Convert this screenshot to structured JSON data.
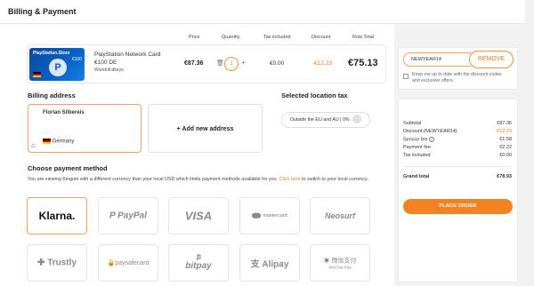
{
  "header": {
    "title": "Billing & Payment"
  },
  "cart": {
    "columns": {
      "price": "Price",
      "quantity": "Quantity",
      "tax": "Tax included",
      "discount": "Discount",
      "row_total": "Row Total"
    },
    "item": {
      "card_title": "PlayStation.Store",
      "card_value": "€100",
      "name_line1": "PlayStation Network Card",
      "name_line2": "€100 DE",
      "seller": "Worldofcdkeys",
      "price": "€87.36",
      "quantity": "1",
      "tax": "€0.00",
      "discount": "-€12.23",
      "row_total": "€75.13"
    }
  },
  "billing": {
    "title": "Billing address",
    "name": "Florian Silbereis",
    "country": "Germany",
    "add_new": "+ Add new address"
  },
  "location_tax": {
    "title": "Selected location tax",
    "value": "Outside the EU and AU | 0%"
  },
  "payment": {
    "title": "Choose payment method",
    "note_before": "You are viewing Kinguin with a different currency than your local USD which limits payment methods available for you. ",
    "note_link": "Click here",
    "note_after": " to switch to your local currency.",
    "methods": [
      "Klarna.",
      "PayPal",
      "VISA",
      "mastercard",
      "Neosurf",
      "Trustly",
      "paysafecard",
      "bitpay",
      "Alipay",
      "微信支付"
    ],
    "wechat_sub": "WeChat Pay"
  },
  "coupon": {
    "code": "NEWYEAR14",
    "remove_label": "REMOVE",
    "keep_text": "Keep me up to date with the discount codes and exclusive offers."
  },
  "summary": {
    "subtotal_label": "Subtotal",
    "subtotal": "€87.36",
    "discount_label": "Discount",
    "discount_code": "(NEWYEAR14)",
    "discount": "-€12.23",
    "service_fee_label": "Service fee",
    "service_fee": "€1.58",
    "payment_fee_label": "Payment fee",
    "payment_fee": "€2.22",
    "tax_label": "Tax included",
    "tax": "€0.00",
    "grand_label": "Grand total",
    "grand": "€78.93",
    "place_order": "PLACE ORDER"
  },
  "colors": {
    "accent": "#f58220",
    "discount": "#f07b22",
    "psn_blue": "#0a62c8"
  }
}
